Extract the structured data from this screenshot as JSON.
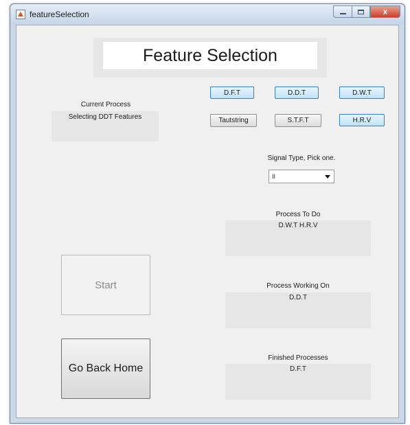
{
  "window": {
    "title": "featureSelection",
    "close_glyph": "x"
  },
  "header": {
    "title": "Feature Selection"
  },
  "current_process": {
    "label": "Current Process",
    "value": "Selecting DDT Features"
  },
  "feature_buttons": {
    "dft": "D.F.T",
    "ddt": "D.D.T",
    "dwt": "D.W.T",
    "tautstring": "Tautstring",
    "stft": "S.T.F.T",
    "hrv": "H.R.V"
  },
  "signal_type": {
    "label": "Signal Type, Pick one.",
    "selected": "II"
  },
  "process_to_do": {
    "label": "Process To Do",
    "value": "D.W.T  H.R.V"
  },
  "process_working_on": {
    "label": "Process Working On",
    "value": "D.D.T"
  },
  "finished_processes": {
    "label": "Finished Processes",
    "value": "D.F.T"
  },
  "actions": {
    "start": "Start",
    "go_back_home": "Go Back Home"
  },
  "colors": {
    "panel_bg": "#e6e6e6",
    "window_bg": "#f0f0f0",
    "selected_button_border": "#3c7fb1",
    "close_button": "#c9402b"
  }
}
